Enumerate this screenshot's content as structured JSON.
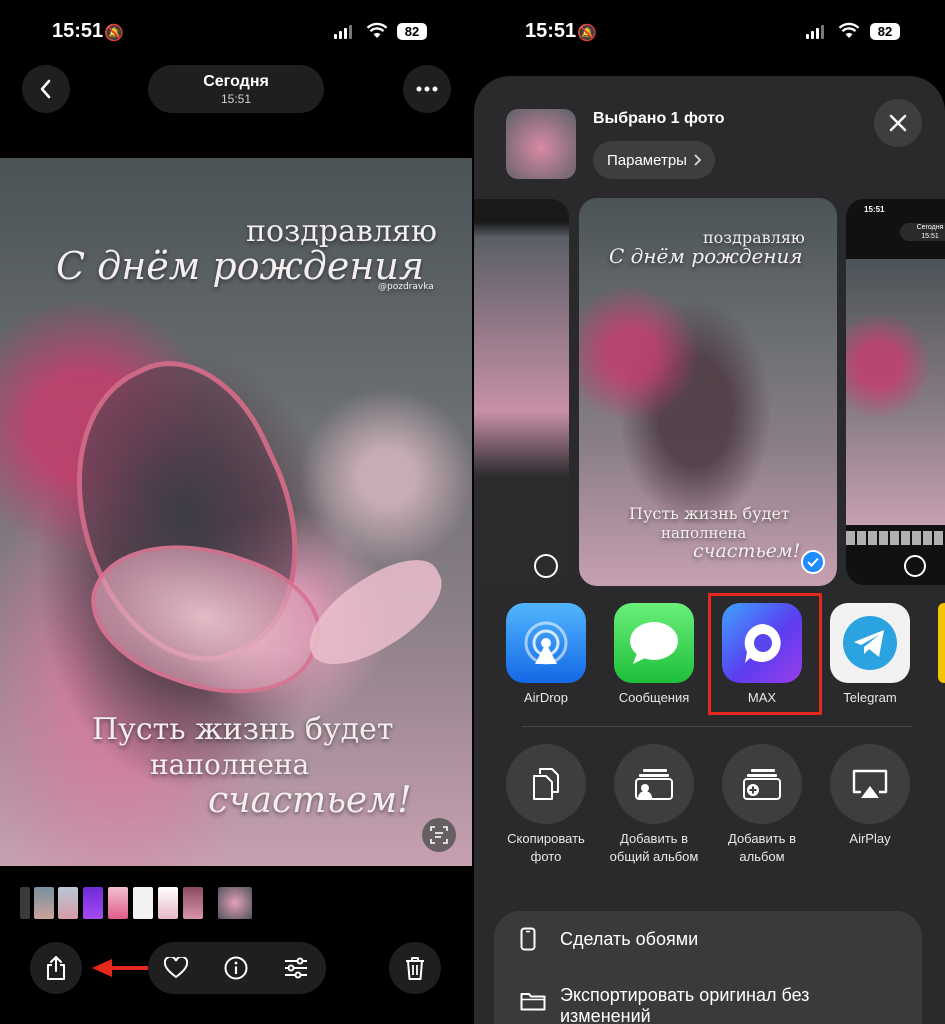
{
  "left_status": {
    "time": "15:51",
    "battery": "82"
  },
  "right_status": {
    "time": "15:51",
    "battery": "82"
  },
  "photo_viewer": {
    "date_title": "Сегодня",
    "date_time": "15:51",
    "photo_text": {
      "line1": "поздравляю",
      "line2": "С днём рождения",
      "signature": "@pozdravka",
      "line3": "Пусть жизнь будет",
      "line4": "наполнена",
      "line5": "счастьем!"
    }
  },
  "share_sheet": {
    "selection_title": "Выбрано 1 фото",
    "options_label": "Параметры",
    "preview_small_text": {
      "title": "Сегодня",
      "time": "15:51",
      "status_time": "15:51"
    },
    "apps": [
      {
        "label": "AirDrop",
        "icon": "airdrop-icon",
        "color": "#1c7cf4"
      },
      {
        "label": "Сообщения",
        "icon": "messages-icon",
        "color": "#34c759"
      },
      {
        "label": "MAX",
        "icon": "max-icon",
        "color": "#5a3df0",
        "highlighted": true
      },
      {
        "label": "Telegram",
        "icon": "telegram-icon",
        "color": "#2aa3e0"
      }
    ],
    "actions": [
      {
        "label": "Скопировать фото",
        "icon": "copy-icon"
      },
      {
        "label": "Добавить в общий альбом",
        "icon": "shared-album-icon"
      },
      {
        "label": "Добавить в альбом",
        "icon": "add-album-icon"
      },
      {
        "label": "AirPlay",
        "icon": "airplay-icon"
      }
    ],
    "list": [
      {
        "label": "Сделать обоями",
        "icon": "phone-icon"
      },
      {
        "label": "Экспортировать оригинал без изменений",
        "icon": "folder-icon"
      }
    ]
  },
  "colors": {
    "highlight_border": "#e5281e",
    "arrow": "#e5281e"
  }
}
